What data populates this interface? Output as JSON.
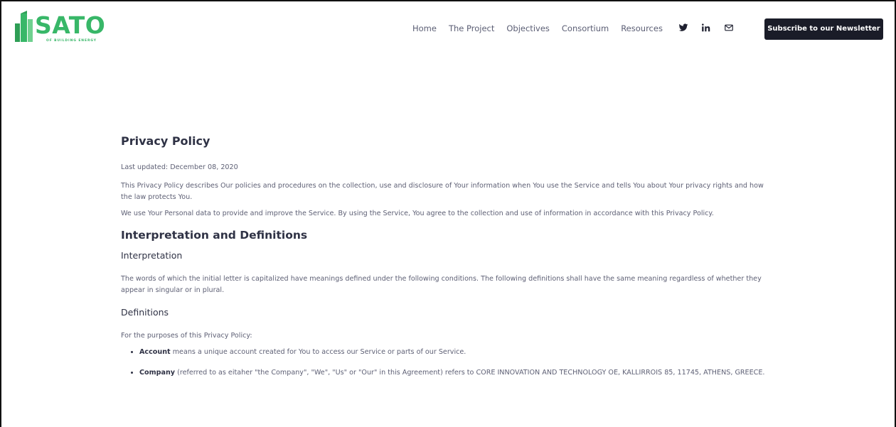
{
  "header": {
    "logo": {
      "name": "SATO",
      "tagline": "OF BUILDING ENERGY",
      "brand_color": "#38b768"
    },
    "nav": [
      "Home",
      "The Project",
      "Objectives",
      "Consortium",
      "Resources"
    ],
    "social_icons": [
      "twitter-icon",
      "linkedin-icon",
      "mail-icon"
    ],
    "subscribe_label": "Subscribe to our Newsletter"
  },
  "content": {
    "title": "Privacy Policy",
    "last_updated": "Last updated: December 08, 2020",
    "intro1": "This Privacy Policy describes Our policies and procedures on the collection, use and disclosure of Your information when You use the Service and tells You about Your privacy rights and how the law protects You.",
    "intro2": "We use Your Personal data to provide and improve the Service. By using the Service, You agree to the collection and use of information in accordance with this Privacy Policy.",
    "section_heading": "Interpretation and Definitions",
    "interpretation_heading": "Interpretation",
    "interpretation_text": "The words of which the initial letter is capitalized have meanings defined under the following conditions. The following definitions shall have the same meaning regardless of whether they appear in singular or in plural.",
    "definitions_heading": "Definitions",
    "definitions_intro": "For the purposes of this Privacy Policy:",
    "definitions": [
      {
        "term": "Account",
        "text": " means a unique account created for You to access our Service or parts of our Service."
      },
      {
        "term": "Company",
        "text": " (referred to as eitaher \"the Company\", \"We\", \"Us\" or \"Our\" in this Agreement) refers to CORE INNOVATION AND TECHNOLOGY OE, KALLIRROIS 85, 11745, ATHENS, GREECE."
      }
    ]
  }
}
